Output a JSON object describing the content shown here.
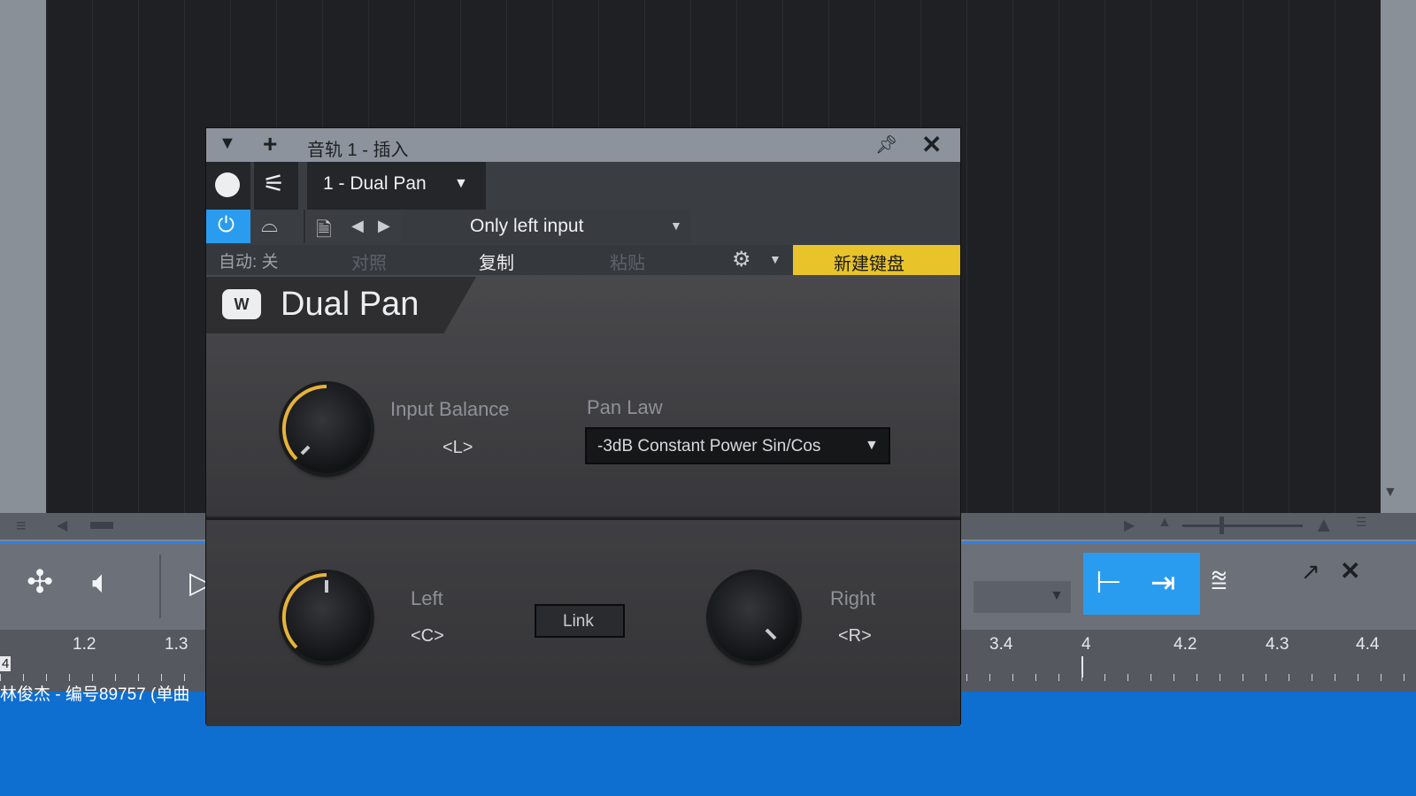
{
  "window": {
    "title": "音轨 1 - 插入"
  },
  "plugin_header": {
    "plugin_selector": "1 - Dual Pan",
    "preset": "Only left input",
    "automation_label": "自动: 关",
    "compare_label": "对照",
    "copy_label": "复制",
    "paste_label": "粘贴",
    "new_keyboard_button": "新建键盘"
  },
  "plugin": {
    "name": "Dual Pan",
    "input_balance_label": "Input Balance",
    "input_balance_value": "<L>",
    "pan_law_label": "Pan Law",
    "pan_law_value": "-3dB Constant Power Sin/Cos",
    "left_label": "Left",
    "left_value": "<C>",
    "link_label": "Link",
    "right_label": "Right",
    "right_value": "<R>"
  },
  "ruler": {
    "left_ticks": [
      "1.2",
      "1.3"
    ],
    "right_ticks": [
      "3.4",
      "4",
      "4.2",
      "4.3",
      "4.4"
    ],
    "bar_marker": "4"
  },
  "clip": {
    "name": "林俊杰 - 编号89757 (单曲"
  },
  "colors": {
    "accent_blue": "#2a9cf0",
    "new_keyboard_yellow": "#e8c32a",
    "knob_arc": "#e6b23a",
    "clip_blue": "#0f6fd0"
  }
}
